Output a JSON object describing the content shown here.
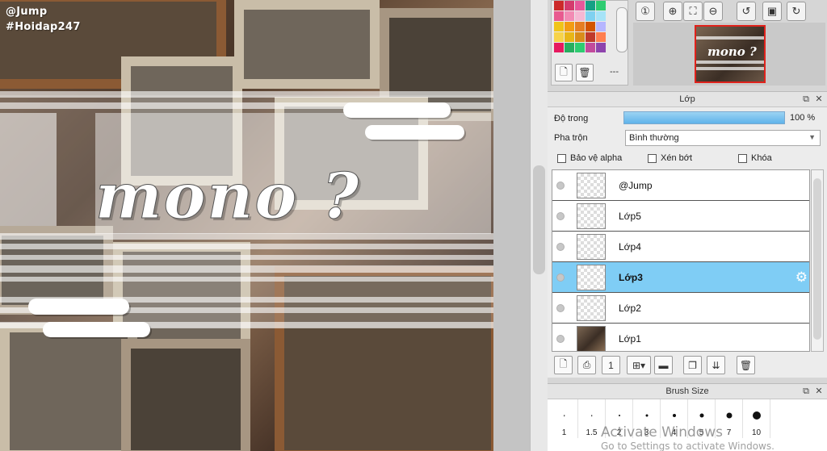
{
  "canvas": {
    "watermark_handle": "@Jump",
    "watermark_tag": "#Hoidap247",
    "title_art": "mono ?"
  },
  "palette": {
    "swatch_colors": [
      "#cc2a2a",
      "#d43b6d",
      "#e6589a",
      "#16a085",
      "#2ecc71",
      "#e85a8f",
      "#f28bb4",
      "#f5b8d3",
      "#7fd1f0",
      "#a6e3f7",
      "#f0c419",
      "#f39c12",
      "#e67e22",
      "#d35400",
      "#b6b6ff",
      "#f7d34a",
      "#e8b617",
      "#d98c1a",
      "#c0392b",
      "#ff7f50",
      "#e6195f",
      "#27ae60",
      "#2ecc71",
      "#c24a9c",
      "#8e44ad"
    ],
    "dash_label": "---"
  },
  "navigator": {
    "preview_title": "mono ?"
  },
  "layer_panel": {
    "title": "Lớp",
    "opacity_label": "Độ trong",
    "opacity_value": "100 %",
    "opacity_fraction": 1.0,
    "blend_label": "Pha trộn",
    "blend_value": "Bình thường",
    "protect_alpha_label": "Bảo vệ alpha",
    "clip_label": "Xén bớt",
    "lock_label": "Khóa",
    "layers": [
      {
        "name": "@Jump",
        "selected": false,
        "thumb": "transparent"
      },
      {
        "name": "Lớp5",
        "selected": false,
        "thumb": "transparent"
      },
      {
        "name": "Lớp4",
        "selected": false,
        "thumb": "transparent"
      },
      {
        "name": "Lớp3",
        "selected": true,
        "thumb": "transparent"
      },
      {
        "name": "Lớp2",
        "selected": false,
        "thumb": "transparent"
      },
      {
        "name": "Lớp1",
        "selected": false,
        "thumb": "photo"
      }
    ]
  },
  "brush_panel": {
    "title": "Brush Size",
    "sizes": [
      "1",
      "1.5",
      "2",
      "3",
      "4",
      "5",
      "7",
      "10"
    ],
    "activate_title": "Activate Windows",
    "activate_sub": "Go to Settings to activate Windows."
  }
}
